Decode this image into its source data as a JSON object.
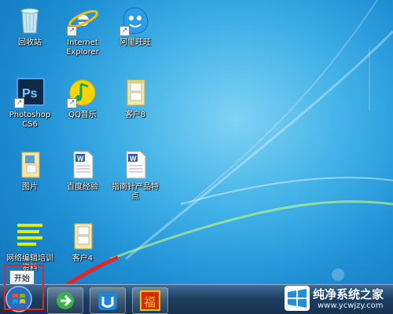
{
  "desktop_icons": [
    {
      "label": "回收站"
    },
    {
      "label": "Internet Explorer"
    },
    {
      "label": "阿里旺旺"
    },
    {
      "label": "Photoshop CS6"
    },
    {
      "label": "QQ音乐"
    },
    {
      "label": "客户8"
    },
    {
      "label": "图片"
    },
    {
      "label": "百度经验"
    },
    {
      "label": "指南针产品特点"
    },
    {
      "label": "网络编辑培训资料"
    },
    {
      "label": "客户4"
    }
  ],
  "tooltip": {
    "text": "开始"
  },
  "watermark": {
    "title": "纯净系统之家",
    "url": "www.ycwjzy.com"
  },
  "colors": {
    "highlight": "#e52424",
    "desktop": "#1e8fd4",
    "taskbar": "#1d3c5e"
  }
}
